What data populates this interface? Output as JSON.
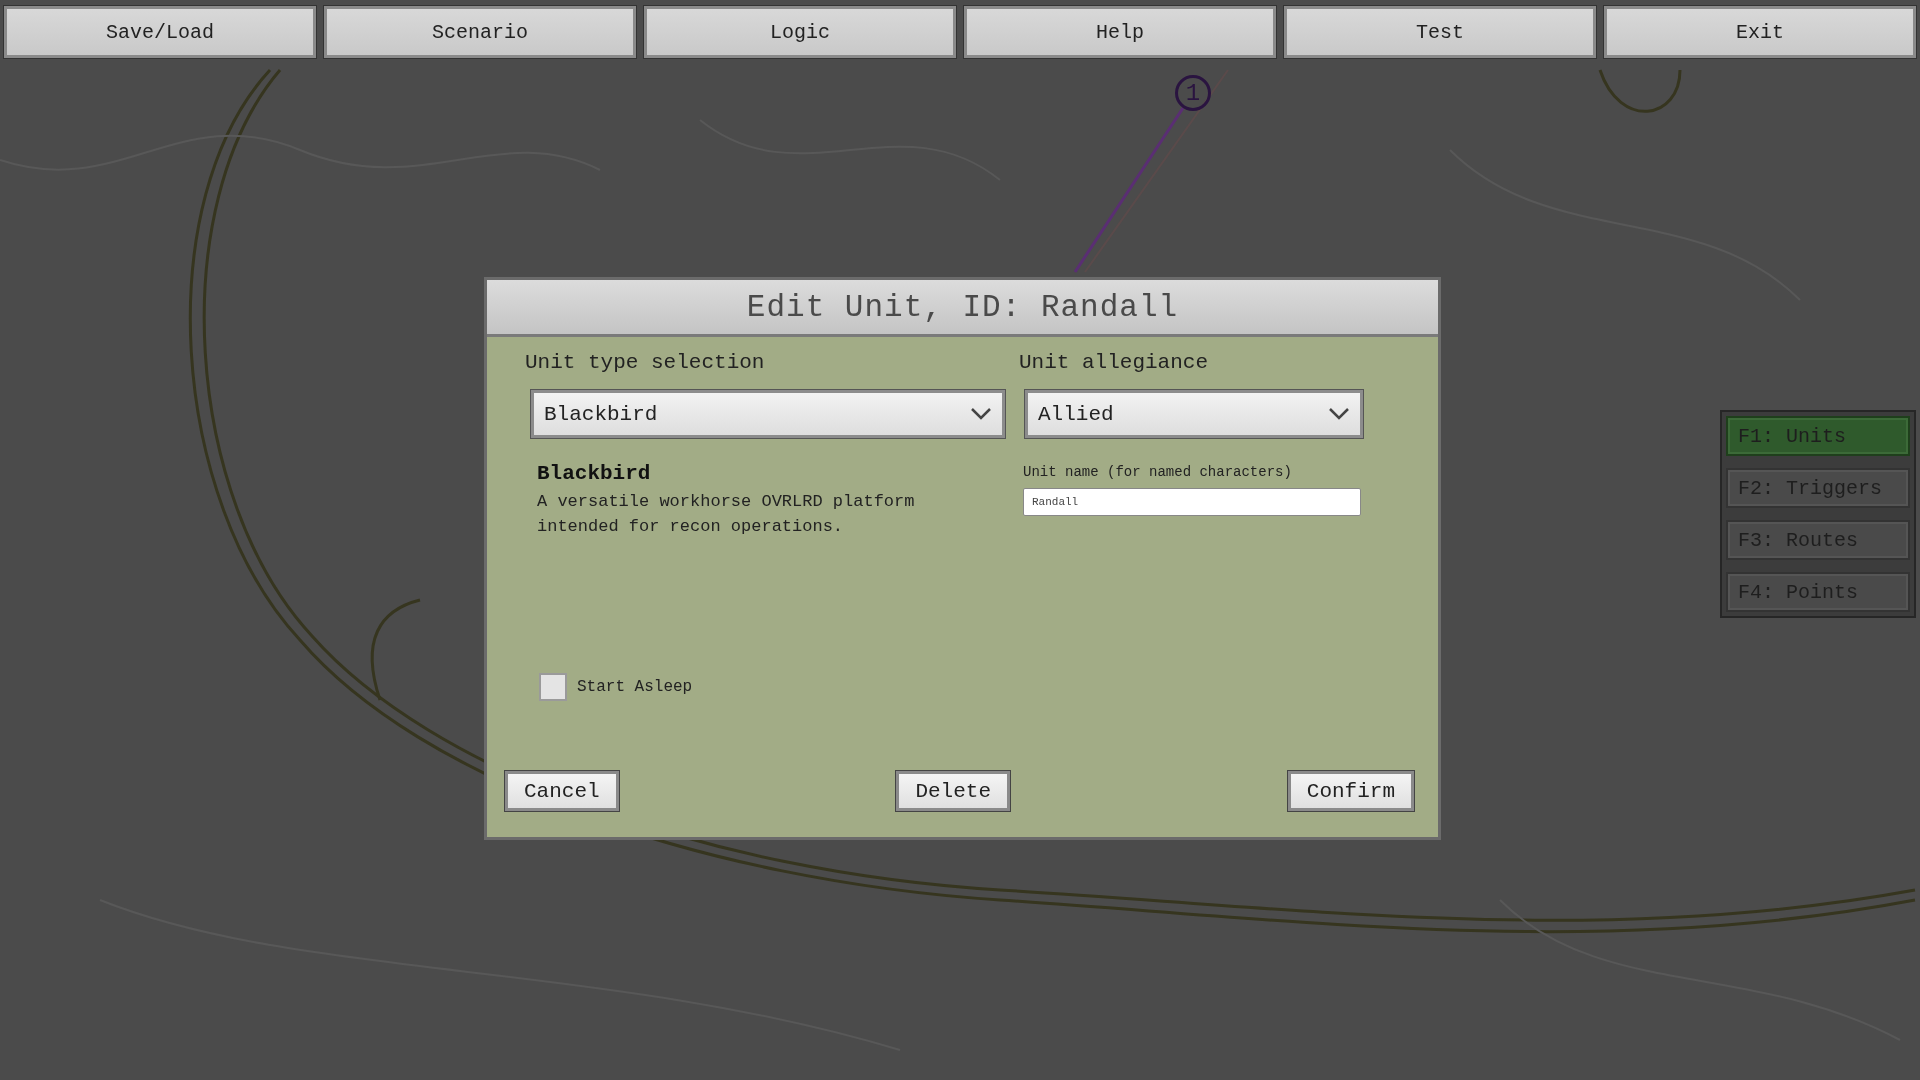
{
  "menu": [
    {
      "label": "Save/Load"
    },
    {
      "label": "Scenario"
    },
    {
      "label": "Logic"
    },
    {
      "label": "Help"
    },
    {
      "label": "Test"
    },
    {
      "label": "Exit"
    }
  ],
  "map": {
    "waypoint": "1"
  },
  "side_tabs": [
    {
      "label": "F1: Units",
      "selected": true
    },
    {
      "label": "F2: Triggers",
      "selected": false
    },
    {
      "label": "F3: Routes",
      "selected": false
    },
    {
      "label": "F4: Points",
      "selected": false
    }
  ],
  "dialog": {
    "title": "Edit Unit, ID: Randall",
    "unit_type": {
      "label": "Unit type selection",
      "value": "Blackbird"
    },
    "allegiance": {
      "label": "Unit allegiance",
      "value": "Allied"
    },
    "description": {
      "title": "Blackbird",
      "text": "A versatile workhorse OVRLRD platform intended for recon operations."
    },
    "unit_name": {
      "label": "Unit name (for named characters)",
      "value": "Randall"
    },
    "start_asleep": {
      "label": "Start Asleep",
      "checked": false
    },
    "buttons": [
      {
        "label": "Cancel"
      },
      {
        "label": "Delete"
      },
      {
        "label": "Confirm"
      }
    ]
  }
}
